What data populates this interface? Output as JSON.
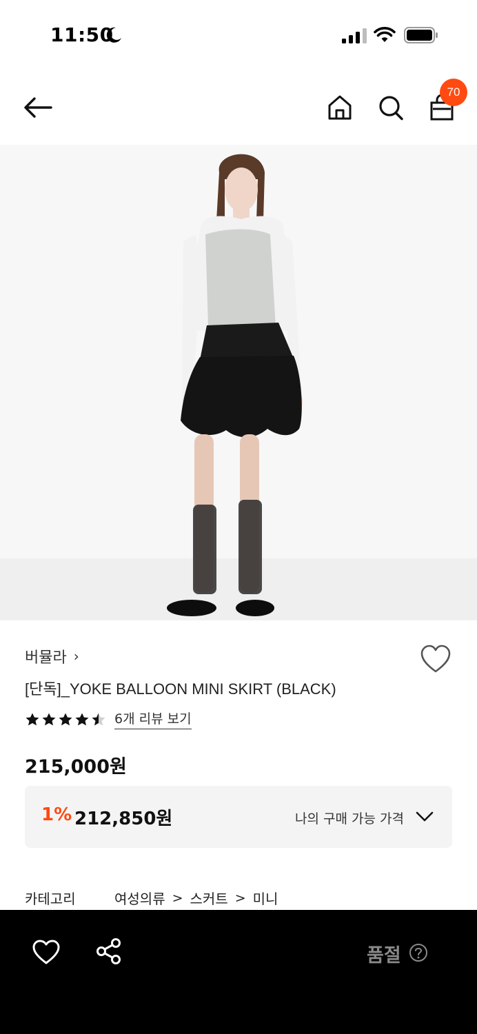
{
  "status_bar": {
    "time": "11:50"
  },
  "cart": {
    "badge_count": "70"
  },
  "product": {
    "brand": "버뮬라",
    "brand_chevron": "›",
    "title": "[단독]_YOKE BALLOON MINI SKIRT (BLACK)",
    "rating": 4.5,
    "review_link": "6개 리뷰 보기",
    "price": "215,000원",
    "my_price": {
      "discount": "1%",
      "price": "212,850원",
      "label": "나의 구매 가능 가격"
    },
    "category": {
      "label": "카테고리",
      "path": [
        "여성의류",
        "스커트",
        "미니"
      ],
      "separator": ">"
    }
  },
  "bottom_bar": {
    "status": "품절"
  },
  "colors": {
    "accent": "#ff4a12",
    "bottom_bar_bg": "#000000",
    "soldout_text": "#8a8a8a",
    "price_box_bg": "#f4f4f4"
  },
  "icons": {
    "nav": [
      "back-arrow-icon",
      "home-icon",
      "search-icon",
      "cart-icon"
    ],
    "bottom": [
      "heart-icon",
      "share-icon",
      "help-icon"
    ]
  }
}
